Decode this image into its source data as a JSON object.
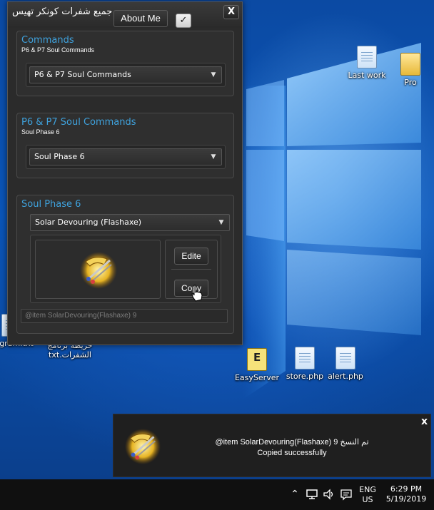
{
  "window": {
    "title": "جميع شفرات كونكر تهيس",
    "about_label": "About Me",
    "check_label": "✓",
    "close_label": "X"
  },
  "groups": [
    {
      "title": "Commands",
      "subtitle": "P6 & P7 Soul Commands",
      "selected": "P6 & P7 Soul Commands"
    },
    {
      "title": "P6 & P7 Soul Commands",
      "subtitle": "Soul Phase 6",
      "selected": "Soul Phase 6"
    },
    {
      "title": "Soul Phase 6",
      "selected": "Solar Devouring (Flashaxe)",
      "edit_label": "Edite",
      "copy_label": "Copy",
      "output_text": "@item SolarDevouring(Flashaxe) 9"
    }
  ],
  "desktop_icons": [
    {
      "label": "Last work",
      "icon": "text-file-icon"
    },
    {
      "label": "Pro",
      "icon": "folder-icon"
    },
    {
      "label": "EasyServer",
      "icon": "exe-icon"
    },
    {
      "label": "store.php",
      "icon": "php-file-icon"
    },
    {
      "label": "alert.php",
      "icon": "php-file-icon"
    },
    {
      "label": "gram.txt",
      "icon": "text-file-icon"
    },
    {
      "label": "خريطة برنامج الشفرات.txt",
      "icon": "text-file-icon"
    }
  ],
  "toast": {
    "line1": "@item SolarDevouring(Flashaxe) 9 تم النسخ",
    "line2": "Copied successfully",
    "close_label": "x"
  },
  "taskbar": {
    "lang_top": "ENG",
    "lang_bottom": "US",
    "time": "6:29 PM",
    "date": "5/19/2019"
  },
  "colors": {
    "accent": "#3fa2dd",
    "window_bg": "#2b2b2b",
    "desktop": "#0a55b8"
  }
}
